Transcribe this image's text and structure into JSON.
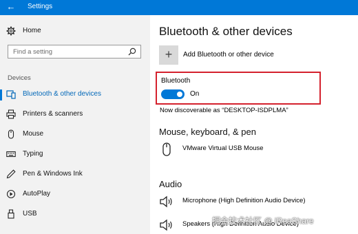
{
  "window": {
    "title": "Settings"
  },
  "sidebar": {
    "home_label": "Home",
    "search_placeholder": "Find a setting",
    "section_label": "Devices",
    "items": [
      {
        "label": "Bluetooth & other devices",
        "icon": "bluetooth-devices-icon",
        "active": true
      },
      {
        "label": "Printers & scanners",
        "icon": "printer-icon"
      },
      {
        "label": "Mouse",
        "icon": "mouse-icon"
      },
      {
        "label": "Typing",
        "icon": "keyboard-icon"
      },
      {
        "label": "Pen & Windows Ink",
        "icon": "pen-icon"
      },
      {
        "label": "AutoPlay",
        "icon": "autoplay-icon"
      },
      {
        "label": "USB",
        "icon": "usb-icon"
      }
    ]
  },
  "main": {
    "title": "Bluetooth & other devices",
    "add_device_label": "Add Bluetooth or other device",
    "bluetooth": {
      "label": "Bluetooth",
      "state": "On"
    },
    "discoverable_text": "Now discoverable as “DESKTOP-ISDPLMA”",
    "mouse_group": {
      "title": "Mouse, keyboard, & pen",
      "devices": [
        "VMware Virtual USB Mouse"
      ]
    },
    "audio_group": {
      "title": "Audio",
      "devices": [
        "Microphone (High Definition Audio Device)",
        "Speakers (High Definition Audio Device)"
      ]
    }
  },
  "colors": {
    "accent": "#0078d7",
    "highlight_box": "#d4202c"
  },
  "watermark": "掘金技术社区 @ iReaShare"
}
